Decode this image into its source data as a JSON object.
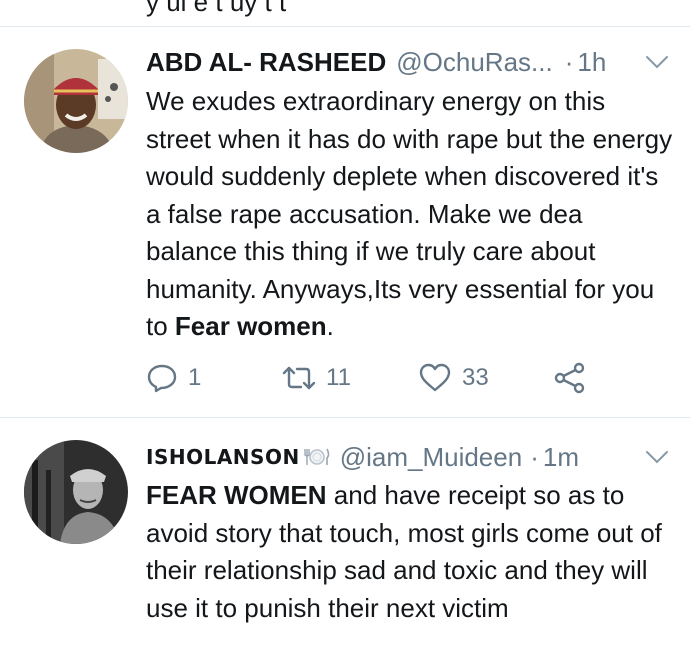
{
  "top_fragment": "y  ul  e  t  uy  t  t",
  "tweets": [
    {
      "display_name": "ABD AL- RASHEED",
      "handle": "@OchuRas...",
      "separator": "·",
      "time": "1h",
      "text_before": "We exudes extraordinary energy on this street when it has do with rape but the energy would suddenly deplete when discovered it's a false rape accusation. Make we dea balance this thing if we truly care about humanity. Anyways,Its very essential for you to ",
      "text_bold": "Fear women",
      "text_after": ".",
      "replies": "1",
      "retweets": "11",
      "likes": "33",
      "icons": {
        "reply": "reply-icon",
        "retweet": "retweet-icon",
        "like": "heart-icon",
        "share": "share-icon",
        "menu": "chevron-down-icon"
      }
    },
    {
      "display_name": "ISHOLANSON",
      "name_emoji": "fork-knife-plate-icon",
      "handle": "@iam_Muideen",
      "separator": "·",
      "time": "1m",
      "text_bold": "FEAR WOMEN",
      "text_after": " and have receipt so as to avoid story that touch, most girls come out of their relationship sad and toxic and they will use it to punish their next victim",
      "icons": {
        "menu": "chevron-down-icon"
      }
    }
  ],
  "colors": {
    "text": "#14171a",
    "secondary": "#657786",
    "divider": "#e1e8ed",
    "background": "#ffffff"
  }
}
